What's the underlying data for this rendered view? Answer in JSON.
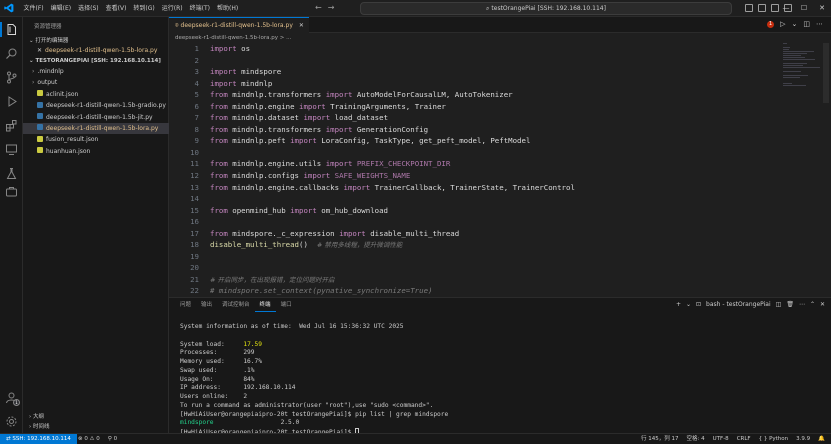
{
  "window": {
    "command_center": "testOrangePiai [SSH: 192.168.10.114]",
    "menu": [
      "文件(F)",
      "编辑(E)",
      "选择(S)",
      "查看(V)",
      "转到(G)",
      "运行(R)",
      "终端(T)",
      "帮助(H)"
    ]
  },
  "colors": {
    "accent": "#0078d4",
    "modified_file": "#e2c08d",
    "keyword": "#c586c0",
    "function": "#dcdcaa",
    "terminal_yellow": "#e5e510",
    "terminal_green": "#23d18b"
  },
  "sidebar": {
    "title": "资源管理器",
    "open_editors_header": "打开的编辑器",
    "open_editor_item": "deepseek-r1-distill-qwen-1.5b-lora.py",
    "root_header": "TESTORANGEPIAI [SSH: 192.168.10.114]",
    "tree": [
      {
        "label": ".mindnlp",
        "type": "folder"
      },
      {
        "label": "output",
        "type": "folder"
      },
      {
        "label": "aclinit.json",
        "type": "json"
      },
      {
        "label": "deepseek-r1-distill-qwen-1.5b-gradio.py",
        "type": "py"
      },
      {
        "label": "deepseek-r1-distill-qwen-1.5b-jit.py",
        "type": "py"
      },
      {
        "label": "deepseek-r1-distill-qwen-1.5b-lora.py",
        "type": "py-selected"
      },
      {
        "label": "fusion_result.json",
        "type": "json"
      },
      {
        "label": "huanhuan.json",
        "type": "json"
      }
    ],
    "outline_label": "大纲",
    "timeline_label": "时间线"
  },
  "editor": {
    "tab_label": "deepseek-r1-distill-qwen-1.5b-lora.py",
    "breadcrumb": "deepseek-r1-distill-qwen-1.5b-lora.py > ...",
    "error_count": "1",
    "lines": [
      {
        "n": "1",
        "code": [
          {
            "t": "import",
            "c": "kw"
          },
          {
            "t": " os",
            "c": "id"
          }
        ]
      },
      {
        "n": "2",
        "code": []
      },
      {
        "n": "3",
        "code": [
          {
            "t": "import",
            "c": "kw"
          },
          {
            "t": " mindspore",
            "c": "id"
          }
        ]
      },
      {
        "n": "4",
        "code": [
          {
            "t": "import",
            "c": "kw"
          },
          {
            "t": " mindnlp",
            "c": "id"
          }
        ]
      },
      {
        "n": "5",
        "code": [
          {
            "t": "from",
            "c": "kw"
          },
          {
            "t": " mindnlp.transformers ",
            "c": "id"
          },
          {
            "t": "import",
            "c": "kw"
          },
          {
            "t": " AutoModelForCausalLM, AutoTokenizer",
            "c": "id"
          }
        ]
      },
      {
        "n": "6",
        "code": [
          {
            "t": "from",
            "c": "kw"
          },
          {
            "t": " mindnlp.engine ",
            "c": "id"
          },
          {
            "t": "import",
            "c": "kw"
          },
          {
            "t": " TrainingArguments, Trainer",
            "c": "id"
          }
        ]
      },
      {
        "n": "7",
        "code": [
          {
            "t": "from",
            "c": "kw"
          },
          {
            "t": " mindnlp.dataset ",
            "c": "id"
          },
          {
            "t": "import",
            "c": "kw"
          },
          {
            "t": " load_dataset",
            "c": "id"
          }
        ]
      },
      {
        "n": "8",
        "code": [
          {
            "t": "from",
            "c": "kw"
          },
          {
            "t": " mindnlp.transformers ",
            "c": "id"
          },
          {
            "t": "import",
            "c": "kw"
          },
          {
            "t": " GenerationConfig",
            "c": "id"
          }
        ]
      },
      {
        "n": "9",
        "code": [
          {
            "t": "from",
            "c": "kw"
          },
          {
            "t": " mindnlp.peft ",
            "c": "id"
          },
          {
            "t": "import",
            "c": "kw"
          },
          {
            "t": " LoraConfig, TaskType, get_peft_model, PeftModel",
            "c": "id"
          }
        ]
      },
      {
        "n": "10",
        "code": []
      },
      {
        "n": "11",
        "code": [
          {
            "t": "from",
            "c": "kw"
          },
          {
            "t": " mindnlp.engine.utils ",
            "c": "id"
          },
          {
            "t": "import",
            "c": "kw"
          },
          {
            "t": " PREFIX_CHECKPOINT_DIR",
            "c": "const"
          }
        ]
      },
      {
        "n": "12",
        "code": [
          {
            "t": "from",
            "c": "kw"
          },
          {
            "t": " mindnlp.configs ",
            "c": "id"
          },
          {
            "t": "import",
            "c": "kw"
          },
          {
            "t": " SAFE_WEIGHTS_NAME",
            "c": "const"
          }
        ]
      },
      {
        "n": "13",
        "code": [
          {
            "t": "from",
            "c": "kw"
          },
          {
            "t": " mindnlp.engine.callbacks ",
            "c": "id"
          },
          {
            "t": "import",
            "c": "kw"
          },
          {
            "t": " TrainerCallback, TrainerState, TrainerControl",
            "c": "id"
          }
        ]
      },
      {
        "n": "14",
        "code": []
      },
      {
        "n": "15",
        "code": [
          {
            "t": "from",
            "c": "kw"
          },
          {
            "t": " openmind_hub ",
            "c": "id"
          },
          {
            "t": "import",
            "c": "kw"
          },
          {
            "t": " om_hub_download",
            "c": "id"
          }
        ]
      },
      {
        "n": "16",
        "code": []
      },
      {
        "n": "17",
        "code": [
          {
            "t": "from",
            "c": "kw"
          },
          {
            "t": " mindspore._c_expression ",
            "c": "id"
          },
          {
            "t": "import",
            "c": "kw"
          },
          {
            "t": " disable_multi_thread",
            "c": "id"
          }
        ]
      },
      {
        "n": "18",
        "code": [
          {
            "t": "disable_multi_thread",
            "c": "fn"
          },
          {
            "t": "()  ",
            "c": "id"
          },
          {
            "t": "# 禁用多线程，提升微调性能",
            "c": "cmt-cjk"
          }
        ]
      },
      {
        "n": "19",
        "code": []
      },
      {
        "n": "20",
        "code": []
      },
      {
        "n": "21",
        "code": [
          {
            "t": "# 开启同步，在出现报错，定位问题时开启",
            "c": "cmt-cjk"
          }
        ]
      },
      {
        "n": "22",
        "code": [
          {
            "t": "# mindspore.set_context(pynative_synchronize=True)",
            "c": "cmt"
          }
        ]
      },
      {
        "n": "23",
        "code": []
      }
    ]
  },
  "panel": {
    "tabs": [
      "问题",
      "输出",
      "调试控制台",
      "终端",
      "端口"
    ],
    "active_tab": "终端",
    "terminal_name": "bash - testOrangePiai",
    "terminal_lines": [
      {
        "text": "System information as of time:  Wed Jul 16 15:36:32 UTC 2025",
        "c": ""
      },
      {
        "text": "",
        "c": ""
      },
      {
        "text": "System load:     ",
        "c": "",
        "v": "17.59"
      },
      {
        "text": "Processes:       299",
        "c": ""
      },
      {
        "text": "Memory used:     16.7%",
        "c": ""
      },
      {
        "text": "Swap used:       .1%",
        "c": ""
      },
      {
        "text": "Usage On:        84%",
        "c": ""
      },
      {
        "text": "IP address:      192.168.10.114",
        "c": ""
      },
      {
        "text": "Users online:    2",
        "c": ""
      },
      {
        "text": "To run a command as administrator(user \"root\"),use \"sudo <command>\".",
        "c": ""
      },
      {
        "text": "[HwHiAiUser@orangepiaipro-20t testOrangePiai]$ pip list | grep mindspore",
        "c": ""
      },
      {
        "text": "mindspore                  2.5.0",
        "c": "green-first"
      },
      {
        "text": "[HwHiAiUser@orangepiaipro-20t testOrangePiai]$ ",
        "c": "cursor"
      }
    ]
  },
  "statusbar": {
    "remote": "SSH: 192.168.10.114",
    "problems": "⊗ 0 ⚠ 0",
    "ports": "⚲ 0",
    "position": "行 145，列 17",
    "spaces": "空格: 4",
    "encoding": "UTF-8",
    "eol": "CRLF",
    "language": "{ } Python",
    "python_version": "3.9.9"
  }
}
